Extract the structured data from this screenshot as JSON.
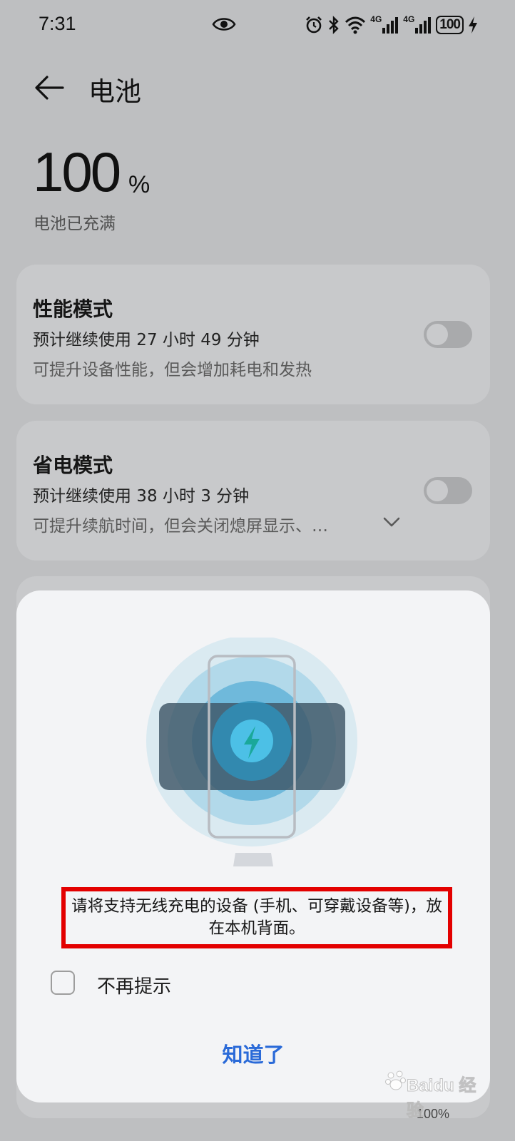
{
  "status_bar": {
    "time": "7:31",
    "network_1": "4G",
    "network_2": "4G",
    "battery": "100"
  },
  "header": {
    "title": "电池"
  },
  "battery": {
    "percent": "100",
    "unit": "%",
    "status": "电池已充满"
  },
  "performance_mode": {
    "title": "性能模式",
    "estimate": "预计继续使用 27 小时 49 分钟",
    "description": "可提升设备性能，但会增加耗电和发热",
    "enabled": false
  },
  "power_saving_mode": {
    "title": "省电模式",
    "estimate": "预计继续使用 38 小时 3 分钟",
    "description": "可提升续航时间，但会关闭熄屏显示、…",
    "enabled": false
  },
  "dialog": {
    "hint": "请将支持无线充电的设备 (手机、可穿戴设备等)，放在本机背面。",
    "checkbox_label": "不再提示",
    "checkbox_checked": false,
    "confirm_label": "知道了"
  },
  "bottom_peek": {
    "percent": "100%"
  },
  "colors": {
    "accent": "#2a6ad8",
    "highlight_box": "#e30000",
    "charge_bolt": "#1aa89a"
  }
}
